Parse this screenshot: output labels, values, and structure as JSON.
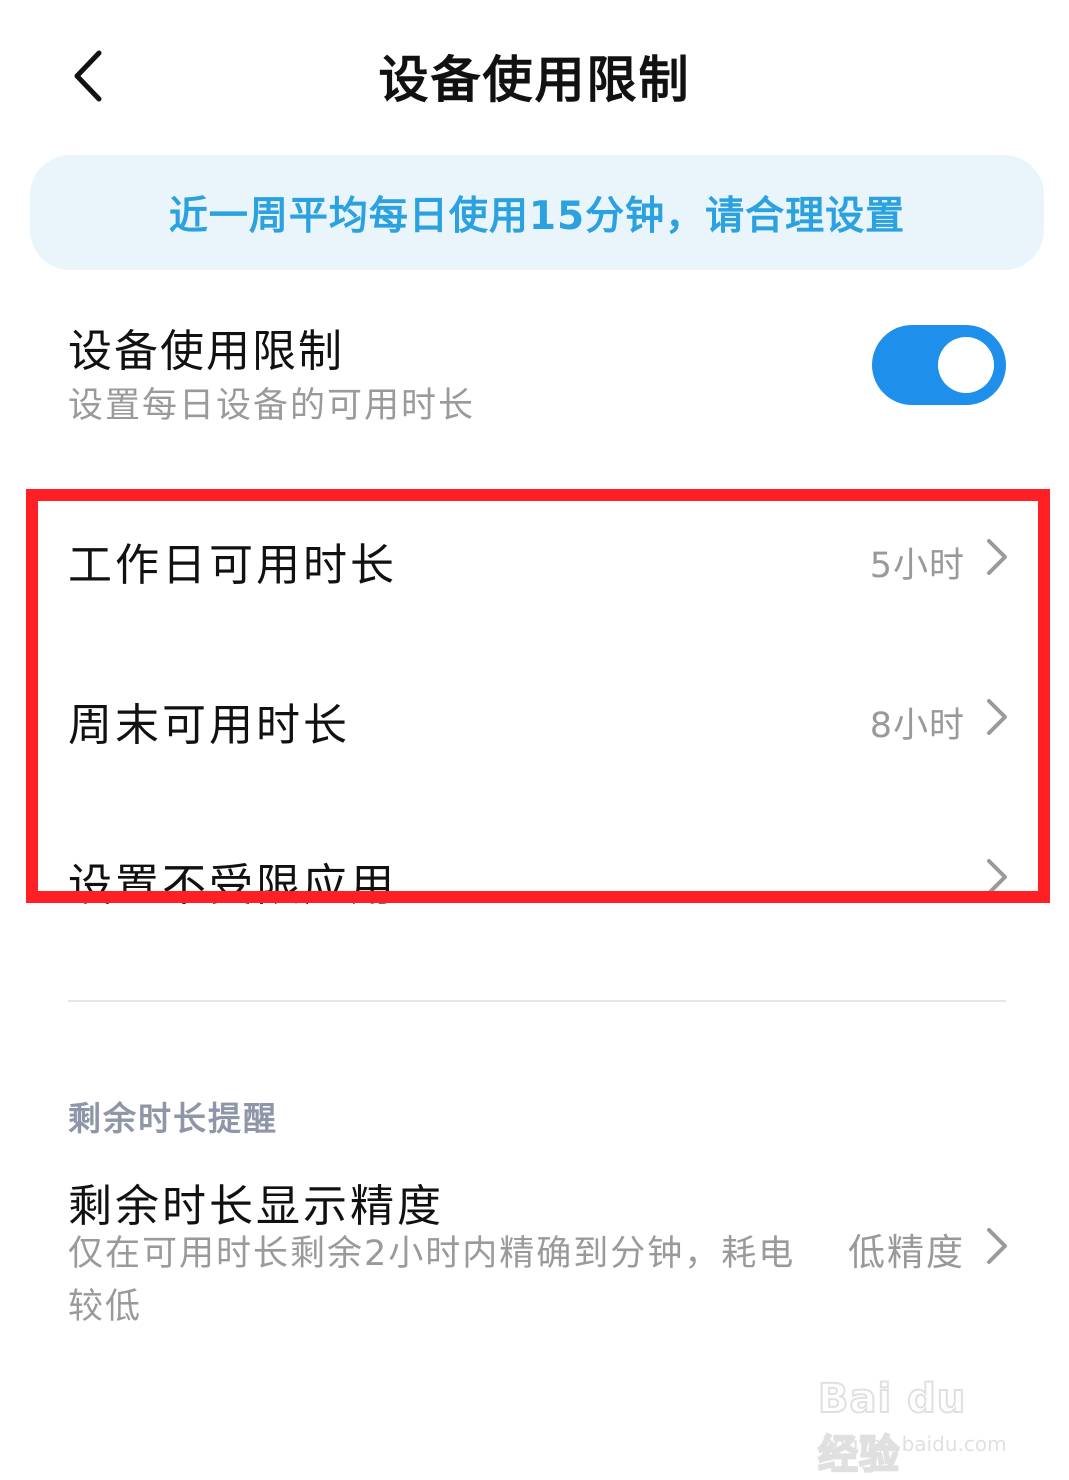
{
  "header": {
    "title": "设备使用限制",
    "back_icon": "chevron-left-icon"
  },
  "banner": {
    "text": "近一周平均每日使用15分钟，请合理设置",
    "color": "#2ba2df"
  },
  "usage_limit": {
    "title": "设备使用限制",
    "subtitle": "设置每日设备的可用时长",
    "enabled": true,
    "toggle_color": "#1e8fea"
  },
  "limits": {
    "items": [
      {
        "label": "工作日可用时长",
        "value": "5小时"
      },
      {
        "label": "周末可用时长",
        "value": "8小时"
      },
      {
        "label": "设置不受限应用",
        "value": ""
      }
    ]
  },
  "reminder": {
    "section_title": "剩余时长提醒",
    "precision_title": "剩余时长显示精度",
    "precision_desc": "仅在可用时长剩余2小时内精确到分钟，耗电较低",
    "precision_value": "低精度"
  },
  "watermark": {
    "logo": "Bai du 经验",
    "url": "jingyan.baidu.com"
  },
  "highlight_color": "#ff1f24"
}
